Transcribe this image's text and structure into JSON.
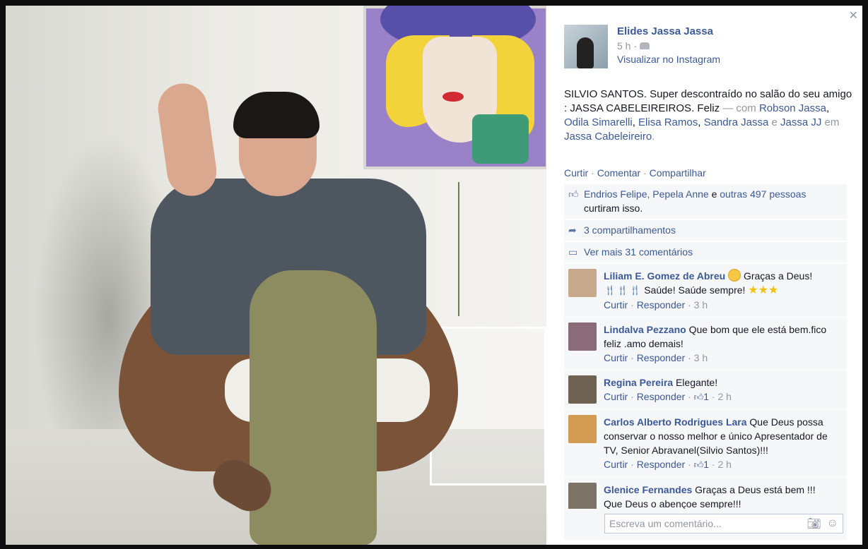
{
  "author": {
    "name": "Elides Jassa Jassa",
    "time": "5 h",
    "separator": "·",
    "source": "Visualizar no Instagram"
  },
  "post": {
    "text_main": "SILVIO SANTOS. Super descontraído no salão do seu amigo : JASSA CABELEIREIROS. Feliz",
    "with_label": "— com",
    "tagged": [
      "Robson Jassa",
      "Odila Simarelli",
      "Elisa Ramos",
      "Sandra Jassa",
      "Jassa JJ"
    ],
    "and_word": "e",
    "at_label": "em",
    "place": "Jassa Cabeleireiro",
    "period": "."
  },
  "actions": {
    "like": "Curtir",
    "comment": "Comentar",
    "share": "Compartilhar",
    "dot": "·"
  },
  "ufi": {
    "likers": "Endrios Felipe, Pepela Anne",
    "likers_and": "e",
    "others": "outras 497 pessoas",
    "likes_suffix": "curtiram isso.",
    "shares": "3 compartilhamentos",
    "more_comments": "Ver mais 31 comentários"
  },
  "comments": [
    {
      "name": "Liliam E. Gomez de Abreu",
      "text1": "Graças a Deus!",
      "text2": "Saúde! Saúde sempre!",
      "like": "Curtir",
      "reply": "Responder",
      "time": "3 h",
      "avatar_color": "#c9a98c"
    },
    {
      "name": "Lindalva Pezzano",
      "text": "Que bom que ele está bem.fico feliz .amo demais!",
      "like": "Curtir",
      "reply": "Responder",
      "time": "3 h",
      "avatar_color": "#8c6b78"
    },
    {
      "name": "Regina Pereira",
      "text": "Elegante!",
      "like": "Curtir",
      "reply": "Responder",
      "likes": "1",
      "time": "2 h",
      "avatar_color": "#6f6252"
    },
    {
      "name": "Carlos Alberto Rodrigues Lara",
      "text": "Que Deus possa conservar o nosso melhor e único Apresentador de TV, Senior Abravanel(Silvio Santos)!!!",
      "like": "Curtir",
      "reply": "Responder",
      "likes": "1",
      "time": "2 h",
      "avatar_color": "#d39a52"
    },
    {
      "name": "Glenice Fernandes",
      "text": "Graças a Deus está bem !!!",
      "text_cut": "Que Deus o abençoe sempre!!!",
      "avatar_color": "#7d7266"
    }
  ],
  "composer": {
    "placeholder": "Escreva um comentário..."
  },
  "icons": {
    "close": "close-icon",
    "friends": "friends-audience-icon",
    "like": "like-thumb-icon",
    "share": "share-arrow-icon",
    "comment": "comment-bubble-icon",
    "camera": "camera-icon",
    "emoji": "emoji-icon"
  },
  "colors": {
    "link": "#3b5998",
    "muted": "#9197a3",
    "panel_bg": "#f6f7f9"
  }
}
